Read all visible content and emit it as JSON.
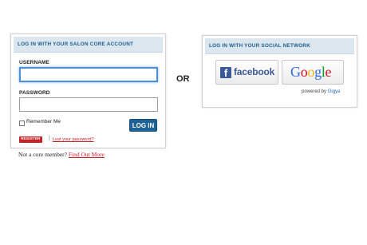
{
  "core_panel": {
    "title": "LOG IN WITH YOUR SALON CORE ACCOUNT",
    "username_label": "USERNAME",
    "username_value": "",
    "password_label": "PASSWORD",
    "password_value": "",
    "remember_label": "Remember Me",
    "remember_checked": false,
    "login_button": "LOG IN",
    "register_button": "REGISTER",
    "divider": "|",
    "lost_password_link": "Lost your password?",
    "not_member_text": "Not a core member?",
    "find_out_more_link": "Find Out More"
  },
  "or_text": "OR",
  "social_panel": {
    "title": "LOG IN WITH YOUR SOCIAL NETWORK",
    "facebook_logo": "f",
    "facebook_label": "facebook",
    "google_label": "Google",
    "powered_by_prefix": "powered by",
    "powered_by_brand": "Gigya"
  },
  "colors": {
    "header_bg": "#dbe6ef",
    "header_text": "#1f5f8f",
    "login_button": "#1f6295",
    "register_button": "#c72025",
    "link": "#c72025",
    "facebook_blue": "#3b5998",
    "focus_border": "#4d90d6"
  },
  "icons": {
    "facebook": "facebook-logo-icon",
    "google": "google-wordmark"
  }
}
